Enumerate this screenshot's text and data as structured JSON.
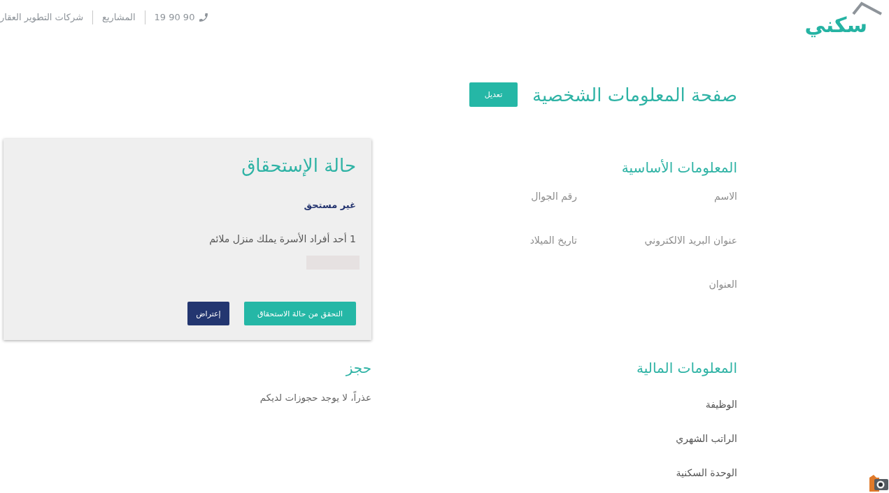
{
  "header": {
    "logo": "سكني",
    "nav": [
      {
        "kind": "phone",
        "label": "19 90 90"
      },
      {
        "kind": "link",
        "label": "المشاريع"
      },
      {
        "kind": "link",
        "label": "شركات التطوير العقار"
      }
    ]
  },
  "profile": {
    "title": "صفحة المعلومات الشخصية",
    "edit_button": "تعديل"
  },
  "basic_info": {
    "heading": "المعلومات الأساسية",
    "fields": [
      "الاسم",
      "رقم الجوال",
      "عنوان البريد الالكتروني",
      "تاريخ الميلاد",
      "العنوان"
    ]
  },
  "eligibility": {
    "title": "حالة الإستحقاق",
    "status": "غير مستحق",
    "reasons": [
      "1 أحد أفراد الأسرة يملك منزل ملائم"
    ],
    "buttons": [
      {
        "kind": "primary",
        "label": "التحقق من حالة الاستحقاق"
      },
      {
        "kind": "secondary",
        "label": "إعتراض"
      }
    ]
  },
  "financial_info": {
    "heading": "المعلومات المالية",
    "fields": [
      "الوظيفة",
      "الراتب الشهري",
      "الوحدة السكنية"
    ]
  },
  "booking": {
    "heading": "حجز",
    "message": "عذراً، لا يوجد حجوزات لديكم"
  }
}
